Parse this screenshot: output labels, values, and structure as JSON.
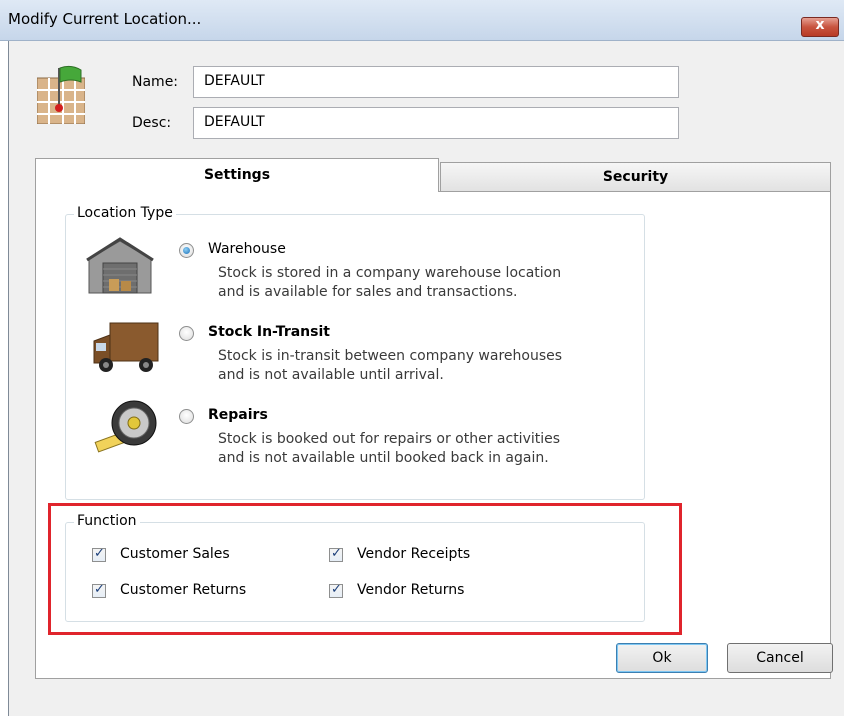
{
  "window": {
    "title": "Modify Current Location...",
    "close_glyph": "x"
  },
  "header": {
    "name_label": "Name:",
    "name_value": "DEFAULT",
    "desc_label": "Desc:",
    "desc_value": "DEFAULT",
    "icon": "map-flag-icon"
  },
  "tabs": [
    {
      "label": "Settings",
      "active": true
    },
    {
      "label": "Security",
      "active": false
    }
  ],
  "location_type": {
    "title": "Location Type",
    "options": [
      {
        "label": "Warehouse",
        "desc1": "Stock is stored in a company warehouse location",
        "desc2": "and is available for sales and transactions.",
        "selected": true,
        "icon": "warehouse-icon"
      },
      {
        "label": "Stock In-Transit",
        "desc1": "Stock is in-transit between company warehouses",
        "desc2": "and is not available until arrival.",
        "selected": false,
        "icon": "delivery-truck-icon"
      },
      {
        "label": "Repairs",
        "desc1": "Stock is booked out for repairs or other activities",
        "desc2": "and is not available until booked back in again.",
        "selected": false,
        "icon": "tape-measure-icon"
      }
    ]
  },
  "function": {
    "title": "Function",
    "items": [
      {
        "label": "Customer Sales",
        "checked": true
      },
      {
        "label": "Vendor Receipts",
        "checked": true
      },
      {
        "label": "Customer Returns",
        "checked": true
      },
      {
        "label": "Vendor Returns",
        "checked": true
      }
    ]
  },
  "buttons": {
    "ok": "Ok",
    "cancel": "Cancel"
  },
  "colors": {
    "highlight": "#e0242c",
    "title_bar": "#c6d6ea",
    "close_button": "#c8543f"
  }
}
